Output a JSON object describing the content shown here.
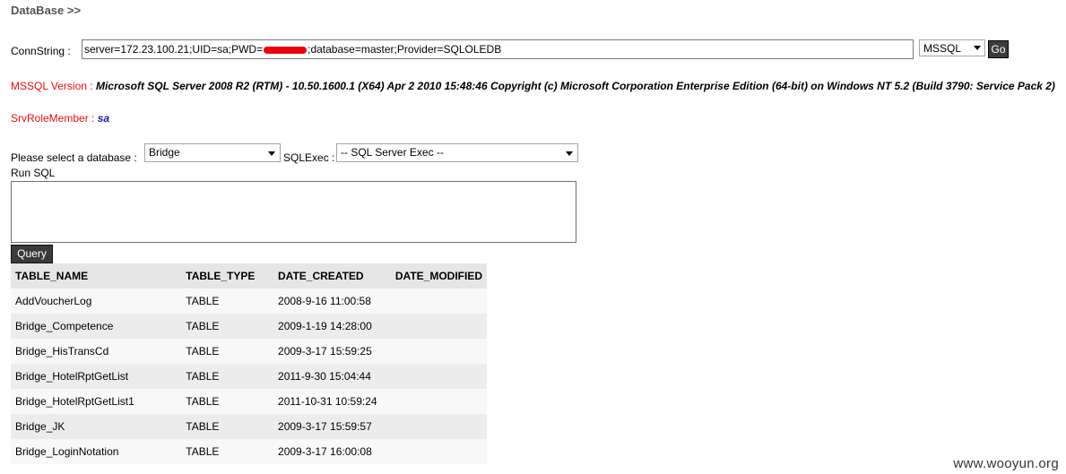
{
  "header": {
    "title": "DataBase >>"
  },
  "conn": {
    "label": "ConnString :",
    "value_before": "server=172.23.100.21;UID=sa;PWD=",
    "value_after": ";database=master;Provider=SQLOLEDB",
    "db_type": "MSSQL",
    "go_label": "Go"
  },
  "version": {
    "label": "MSSQL Version",
    "sep": " : ",
    "text": "Microsoft SQL Server 2008 R2 (RTM) - 10.50.1600.1 (X64) Apr 2 2010 15:48:46 Copyright (c) Microsoft Corporation Enterprise Edition (64-bit) on Windows NT 5.2 (Build 3790: Service Pack 2)"
  },
  "role": {
    "label": "SrvRoleMember",
    "sep": " : ",
    "value": "sa"
  },
  "db_select": {
    "label": "Please select a database :",
    "selected": "Bridge",
    "exec_label": "SQLExec :",
    "exec_selected": "-- SQL Server Exec --"
  },
  "run_sql": {
    "label": "Run SQL",
    "value": ""
  },
  "query_label": "Query",
  "table": {
    "headers": [
      "TABLE_NAME",
      "TABLE_TYPE",
      "DATE_CREATED",
      "DATE_MODIFIED"
    ],
    "rows": [
      [
        "AddVoucherLog",
        "TABLE",
        "2008-9-16 11:00:58",
        ""
      ],
      [
        "Bridge_Competence",
        "TABLE",
        "2009-1-19 14:28:00",
        ""
      ],
      [
        "Bridge_HisTransCd",
        "TABLE",
        "2009-3-17 15:59:25",
        ""
      ],
      [
        "Bridge_HotelRptGetList",
        "TABLE",
        "2011-9-30 15:04:44",
        ""
      ],
      [
        "Bridge_HotelRptGetList1",
        "TABLE",
        "2011-10-31 10:59:24",
        ""
      ],
      [
        "Bridge_JK",
        "TABLE",
        "2009-3-17 15:59:57",
        ""
      ],
      [
        "Bridge_LoginNotation",
        "TABLE",
        "2009-3-17 16:00:08",
        ""
      ]
    ]
  },
  "watermark": "www.wooyun.org",
  "colors": {
    "label_red": "#e01010",
    "role_blue": "#1a1aa6",
    "button_dark": "#3a3a3a"
  }
}
